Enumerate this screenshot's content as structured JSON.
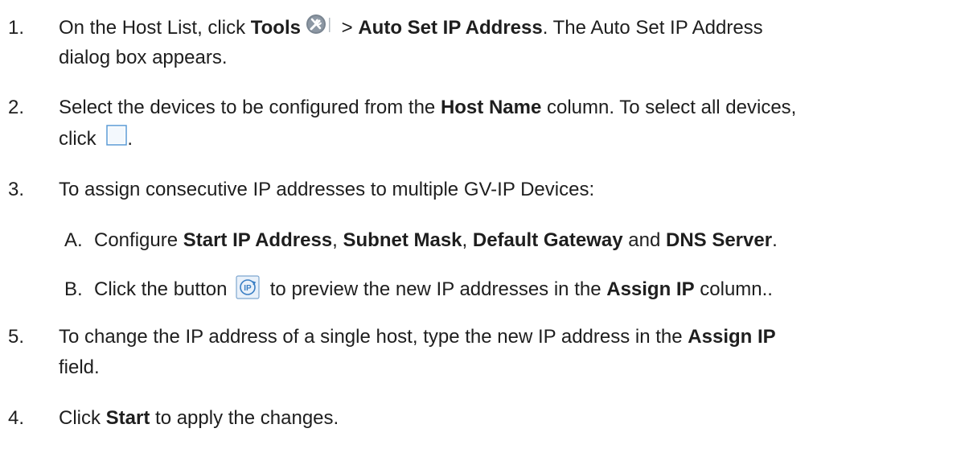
{
  "steps": [
    {
      "num": "1.",
      "t1": "On the Host List, click ",
      "b1": "Tools",
      "t2": " > ",
      "b2": "Auto Set IP Address",
      "t3": ". The Auto Set IP Address",
      "line2": "dialog box appears."
    },
    {
      "num": "2.",
      "t1": "Select the devices to be configured from the ",
      "b1": "Host Name",
      "t2": " column. To select all devices,",
      "line2_a": "click ",
      "line2_b": "."
    },
    {
      "num": "3.",
      "t1": "To assign consecutive IP addresses to multiple GV-IP Devices:",
      "subA": {
        "label": "A.",
        "t1": "Configure ",
        "b1": "Start IP Address",
        "t2": ", ",
        "b2": "Subnet Mask",
        "t3": ", ",
        "b3": "Default Gateway",
        "t4": " and ",
        "b4": "DNS Server",
        "t5": "."
      },
      "subB": {
        "label": "B.",
        "t1": "Click the button ",
        "t2": " to preview the new IP addresses in the ",
        "b1": "Assign IP",
        "t3": " column.."
      }
    },
    {
      "num": "5.",
      "t1": "To change the IP address of a single host, type the new IP address in the ",
      "b1": "Assign IP",
      "line2": "field."
    },
    {
      "num": "4.",
      "t1": "Click ",
      "b1": "Start",
      "t2": " to apply the changes."
    }
  ],
  "icons": {
    "tools": "tools-icon",
    "select_all": "checkbox-icon",
    "preview_ip": "ip-refresh-icon"
  }
}
